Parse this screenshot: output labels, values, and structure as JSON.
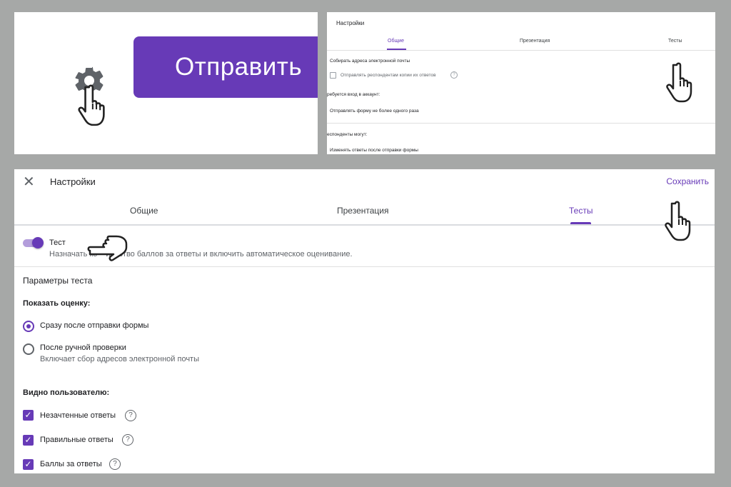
{
  "panel_a": {
    "send_button_label": "Отправить"
  },
  "panel_b": {
    "title": "Настройки",
    "tabs": [
      "Общие",
      "Презентация",
      "Тесты"
    ],
    "collect_emails": "Собирать адреса электронной почты",
    "send_copies": "Отправлять респондентам копии их ответов",
    "requires_login": "ребуется вход в аккаунт:",
    "limit_one": "Отправлять форму не более одного раза",
    "respondents_can": "еспонденты могут:",
    "edit_after": "Изменять ответы после отправки формы"
  },
  "panel_c": {
    "title": "Настройки",
    "save_label": "Сохранить",
    "tabs": [
      "Общие",
      "Презентация",
      "Тесты"
    ],
    "quiz_toggle_label": "Тест",
    "quiz_toggle_on": true,
    "quiz_description_visible": "Назначать ко",
    "quiz_description_rest": "ичество баллов за ответы и включить автоматическое оценивание.",
    "section_title": "Параметры теста",
    "show_grade_label": "Показать оценку:",
    "grade_options": [
      {
        "label": "Сразу после отправки формы",
        "selected": true
      },
      {
        "label": "После ручной проверки",
        "hint": "Включает сбор адресов электронной почты",
        "selected": false
      }
    ],
    "visible_label": "Видно пользователю:",
    "visible_options": [
      {
        "label": "Незачтенные ответы",
        "checked": true
      },
      {
        "label": "Правильные ответы",
        "checked": true
      },
      {
        "label": "Баллы за ответы",
        "checked": true
      }
    ]
  },
  "colors": {
    "accent": "#673ab7",
    "background": "#a6a8a7"
  },
  "icons": [
    "gear-icon",
    "pointer-hand-icon",
    "close-icon",
    "help-icon",
    "checkbox-icon"
  ]
}
